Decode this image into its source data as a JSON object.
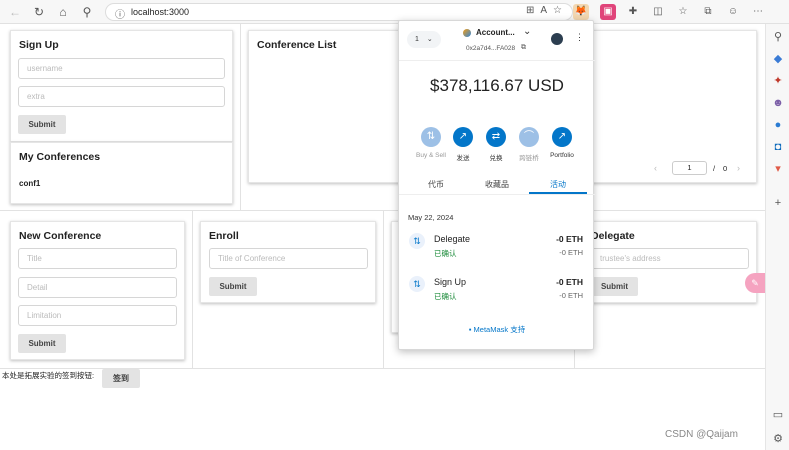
{
  "browser": {
    "url": "localhost:3000"
  },
  "sign_up": {
    "title": "Sign Up",
    "username_placeholder": "username",
    "extra_placeholder": "extra",
    "submit_label": "Submit"
  },
  "my_conferences": {
    "title": "My Conferences",
    "items": [
      "conf1"
    ]
  },
  "conference_list": {
    "title": "Conference List",
    "page_current": "1",
    "page_separator": "/",
    "page_total": "0"
  },
  "new_conference": {
    "title": "New Conference",
    "title_placeholder": "Title",
    "detail_placeholder": "Detail",
    "limitation_placeholder": "Limitation",
    "submit_label": "Submit"
  },
  "enroll": {
    "title": "Enroll",
    "title_placeholder": "Title of Conference",
    "submit_label": "Submit"
  },
  "delegate": {
    "title": "Delegate",
    "address_placeholder": "trustee's address",
    "submit_label": "Submit"
  },
  "extension_row": {
    "label": "本处是拓展实验的签到按钮:",
    "button_label": "签到"
  },
  "metamask": {
    "network_badge": "1",
    "account_name": "Account...",
    "account_address": "0x2a7d4...FA028",
    "balance": "$378,116.67 USD",
    "actions": [
      {
        "label": "Buy & Sell",
        "icon": "buy-sell-icon"
      },
      {
        "label": "发送",
        "icon": "send-icon"
      },
      {
        "label": "兑换",
        "icon": "swap-icon"
      },
      {
        "label": "跨链桥",
        "icon": "bridge-icon"
      },
      {
        "label": "Portfolio",
        "icon": "portfolio-icon"
      }
    ],
    "tabs": [
      "代币",
      "收藏品",
      "活动"
    ],
    "active_tab": "活动",
    "activity_date": "May 22, 2024",
    "transactions": [
      {
        "name": "Delegate",
        "status": "已确认",
        "amount": "-0 ETH",
        "sub_amount": "-0 ETH"
      },
      {
        "name": "Sign Up",
        "status": "已确认",
        "amount": "-0 ETH",
        "sub_amount": "-0 ETH"
      }
    ],
    "support_link": "MetaMask 支持"
  },
  "watermark": "CSDN @Qaijam",
  "colors": {
    "metamask_blue": "#0376c9",
    "confirmed_green": "#1c8b3a",
    "button_gray": "#e3e3e3"
  }
}
